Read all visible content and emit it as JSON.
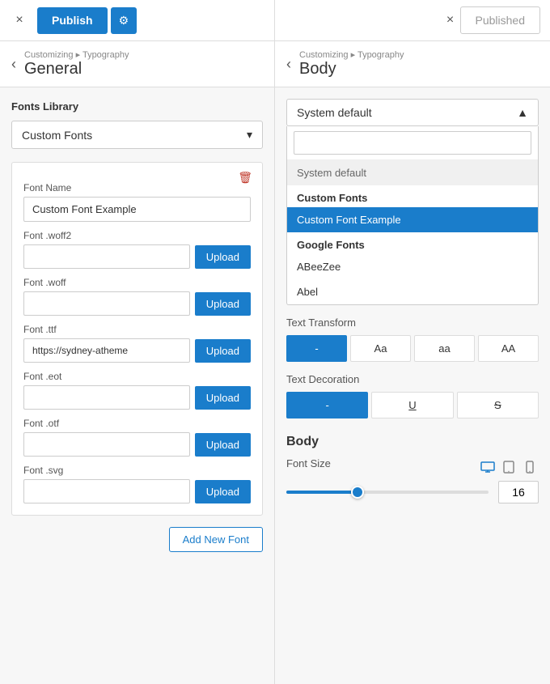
{
  "left_header": {
    "close_label": "×",
    "publish_label": "Publish",
    "gear_label": "⚙",
    "breadcrumb": "Customizing ▸ Typography",
    "page_title": "General",
    "back_arrow": "‹"
  },
  "right_header": {
    "close_label": "×",
    "published_label": "Published",
    "breadcrumb": "Customizing ▸ Typography",
    "page_title": "Body",
    "back_arrow": "‹"
  },
  "left_panel": {
    "fonts_library_label": "Fonts Library",
    "dropdown_label": "Custom Fonts",
    "dropdown_chevron": "▾",
    "font_card": {
      "delete_icon": "🗑",
      "font_name_label": "Font Name",
      "font_name_value": "Custom Font Example",
      "woff2_label": "Font .woff2",
      "woff2_value": "",
      "woff_label": "Font .woff",
      "woff_value": "",
      "ttf_label": "Font .ttf",
      "ttf_value": "https://sydney-atheme",
      "eot_label": "Font .eot",
      "eot_value": "",
      "otf_label": "Font .otf",
      "otf_value": "",
      "svg_label": "Font .svg",
      "svg_value": "",
      "upload_btn_label": "Upload"
    },
    "add_new_font_label": "Add New Font"
  },
  "right_panel": {
    "font_select_value": "System default",
    "font_select_arrow": "▲",
    "search_placeholder": "",
    "dropdown_items": {
      "system_label": "System default",
      "custom_fonts_group": "Custom Fonts",
      "custom_font_item": "Custom Font Example",
      "google_fonts_group": "Google Fonts",
      "google_font_1": "ABeeZee",
      "google_font_2": "Abel"
    },
    "text_transform_label": "Text Transform",
    "transform_buttons": [
      {
        "label": "-",
        "active": true,
        "key": "none"
      },
      {
        "label": "Aa",
        "active": false,
        "key": "capitalize"
      },
      {
        "label": "aa",
        "active": false,
        "key": "lowercase"
      },
      {
        "label": "AA",
        "active": false,
        "key": "uppercase"
      }
    ],
    "text_decoration_label": "Text Decoration",
    "decoration_buttons": [
      {
        "label": "-",
        "active": true,
        "key": "none"
      },
      {
        "label": "U̲",
        "active": false,
        "key": "underline"
      },
      {
        "label": "S̶",
        "active": false,
        "key": "strikethrough"
      }
    ],
    "body_section": {
      "title": "Body",
      "font_size_label": "Font Size",
      "font_size_value": "16",
      "slider_percent": 35
    }
  }
}
